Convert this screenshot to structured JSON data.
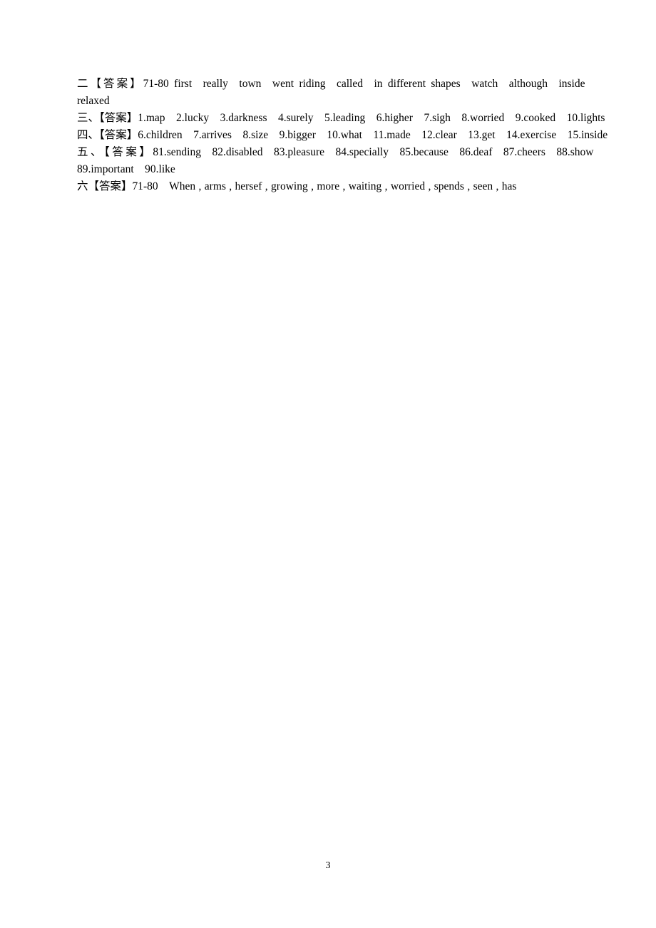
{
  "document": {
    "background_color": "#ffffff",
    "text_color": "#000000",
    "page_number": "3"
  },
  "answers": [
    {
      "id": "answer-block-2",
      "marker": "二",
      "label": "【答案】",
      "range": "71-80",
      "body": "二【答案】71-80 first really town went riding called in different shapes watch although inside relaxed",
      "items": [
        "first",
        "really",
        "town",
        "went riding",
        "called",
        "in different shapes",
        "watch",
        "although",
        "inside",
        "relaxed"
      ]
    },
    {
      "id": "answer-block-3",
      "marker": "三、",
      "label": "【答案】",
      "range": "",
      "body": "三、【答案】1.map 2.lucky 3.darkness 4.surely 5.leading 6.higher 7.sigh 8.worried 9.cooked 10.lights",
      "items": [
        "1.map",
        "2.lucky",
        "3.darkness",
        "4.surely",
        "5.leading",
        "6.higher",
        "7.sigh",
        "8.worried",
        "9.cooked",
        "10.lights"
      ]
    },
    {
      "id": "answer-block-4",
      "marker": "四、",
      "label": "【答案】",
      "range": "",
      "body": "四、【答案】6.children 7.arrives 8.size 9.bigger 10.what 11.made 12.clear 13.get 14.exercise 15.inside",
      "items": [
        "6.children",
        "7.arrives",
        "8.size",
        "9.bigger",
        "10.what",
        "11.made",
        "12.clear",
        "13.get",
        "14.exercise",
        "15.inside"
      ]
    },
    {
      "id": "answer-block-5",
      "marker": "五、",
      "label": "【答案】",
      "range": "",
      "body": "五、【答案】81.sending 82.disabled 83.pleasure 84.specially 85.because 86.deaf 87.cheers 88.show 89.important 90.like",
      "items": [
        "81.sending",
        "82.disabled",
        "83.pleasure",
        "84.specially",
        "85.because",
        "86.deaf",
        "87.cheers",
        "88.show",
        "89.important",
        "90.like"
      ]
    },
    {
      "id": "answer-block-6",
      "marker": "六",
      "label": "【答案】",
      "range": "71-80",
      "body": "六【答案】71-80 When , arms , hersef , growing , more , waiting , worried , spends , seen , has",
      "items": [
        "When",
        "arms",
        "hersef",
        "growing",
        "more",
        "waiting",
        "worried",
        "spends",
        "seen",
        "has"
      ]
    }
  ]
}
